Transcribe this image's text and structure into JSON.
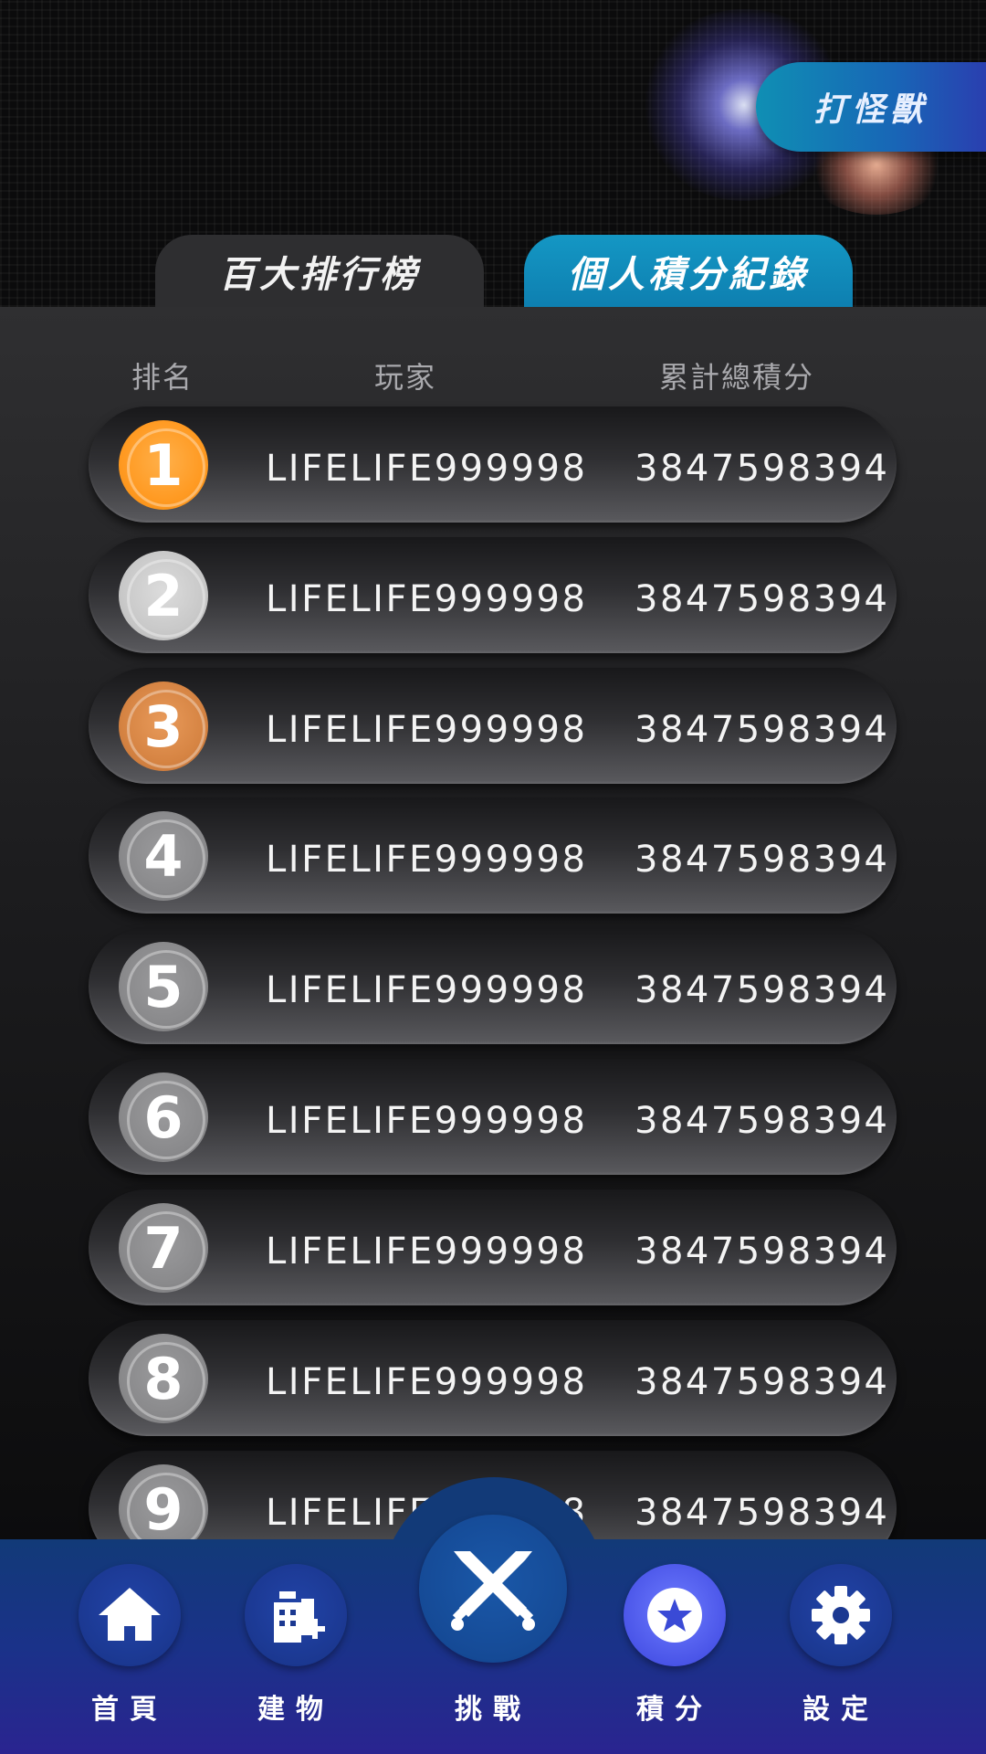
{
  "header": {
    "monster_button": "打怪獸",
    "tabs": [
      {
        "label": "百大排行榜",
        "active": false
      },
      {
        "label": "個人積分紀錄",
        "active": true
      }
    ]
  },
  "table": {
    "columns": [
      "排名",
      "玩家",
      "累計總積分"
    ],
    "rows": [
      {
        "rank": "1",
        "player": "LIFELIFE999998",
        "score": "3847598394",
        "medal": "gold"
      },
      {
        "rank": "2",
        "player": "LIFELIFE999998",
        "score": "3847598394",
        "medal": "silver"
      },
      {
        "rank": "3",
        "player": "LIFELIFE999998",
        "score": "3847598394",
        "medal": "bronze"
      },
      {
        "rank": "4",
        "player": "LIFELIFE999998",
        "score": "3847598394",
        "medal": "grey"
      },
      {
        "rank": "5",
        "player": "LIFELIFE999998",
        "score": "3847598394",
        "medal": "grey"
      },
      {
        "rank": "6",
        "player": "LIFELIFE999998",
        "score": "3847598394",
        "medal": "grey"
      },
      {
        "rank": "7",
        "player": "LIFELIFE999998",
        "score": "3847598394",
        "medal": "grey"
      },
      {
        "rank": "8",
        "player": "LIFELIFE999998",
        "score": "3847598394",
        "medal": "grey"
      },
      {
        "rank": "9",
        "player": "LIFELIFE999998",
        "score": "3847598394",
        "medal": "grey"
      }
    ]
  },
  "nav": {
    "items": [
      {
        "label": "首頁",
        "icon": "home-icon"
      },
      {
        "label": "建物",
        "icon": "building-icon"
      },
      {
        "label": "挑戰",
        "icon": "swords-icon"
      },
      {
        "label": "積分",
        "icon": "star-badge-icon",
        "active": true
      },
      {
        "label": "設定",
        "icon": "gear-icon"
      }
    ]
  },
  "colors": {
    "tab_active": "#1497c4",
    "gold": "#ff9a22",
    "silver": "#c9c9c9",
    "bronze": "#d68443",
    "nav_bg": "#1a3289"
  }
}
